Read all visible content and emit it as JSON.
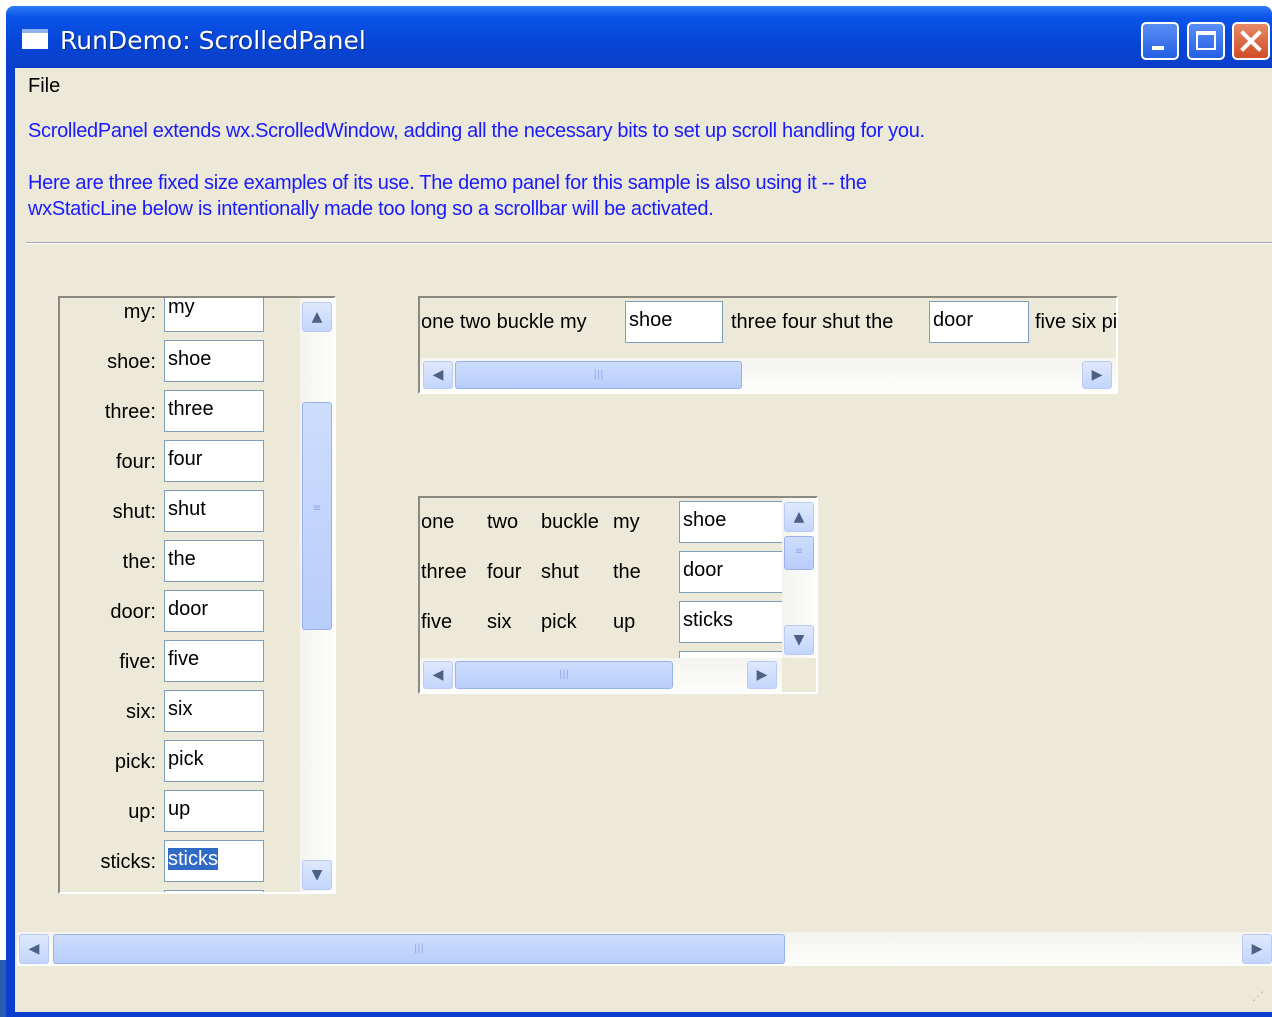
{
  "window": {
    "title": "RunDemo: ScrolledPanel",
    "controls": {
      "minimize": "_",
      "maximize": "□",
      "close": "✕"
    }
  },
  "menu": {
    "items": [
      "File"
    ]
  },
  "description": {
    "line1": "ScrolledPanel extends wx.ScrolledWindow, adding all the necessary bits to set up scroll handling for you.",
    "line2": "Here are three fixed size examples of its use. The demo panel for this sample is also using it -- the",
    "line3": "wxStaticLine below is intentionally made too long so a scrollbar will be activated."
  },
  "panel1": {
    "rows": [
      {
        "label": "my:",
        "value": "my"
      },
      {
        "label": "shoe:",
        "value": "shoe"
      },
      {
        "label": "three:",
        "value": "three"
      },
      {
        "label": "four:",
        "value": "four"
      },
      {
        "label": "shut:",
        "value": "shut"
      },
      {
        "label": "the:",
        "value": "the"
      },
      {
        "label": "door:",
        "value": "door"
      },
      {
        "label": "five:",
        "value": "five"
      },
      {
        "label": "six:",
        "value": "six"
      },
      {
        "label": "pick:",
        "value": "pick"
      },
      {
        "label": "up:",
        "value": "up"
      },
      {
        "label": "sticks:",
        "value": "sticks"
      }
    ]
  },
  "panel2": {
    "text1": "one two buckle my",
    "field1": "shoe",
    "text2": "three four shut the",
    "field2": "door",
    "text3": "five six pick"
  },
  "panel3": {
    "rows": [
      {
        "words": [
          "one",
          "two",
          "buckle",
          "my"
        ],
        "value": "shoe"
      },
      {
        "words": [
          "three",
          "four",
          "shut",
          "the"
        ],
        "value": "door"
      },
      {
        "words": [
          "five",
          "six",
          "pick",
          "up"
        ],
        "value": "sticks"
      }
    ]
  },
  "icons": {
    "up": "⌃",
    "down": "⌄",
    "left": "‹",
    "right": "›",
    "grip": "|||"
  }
}
